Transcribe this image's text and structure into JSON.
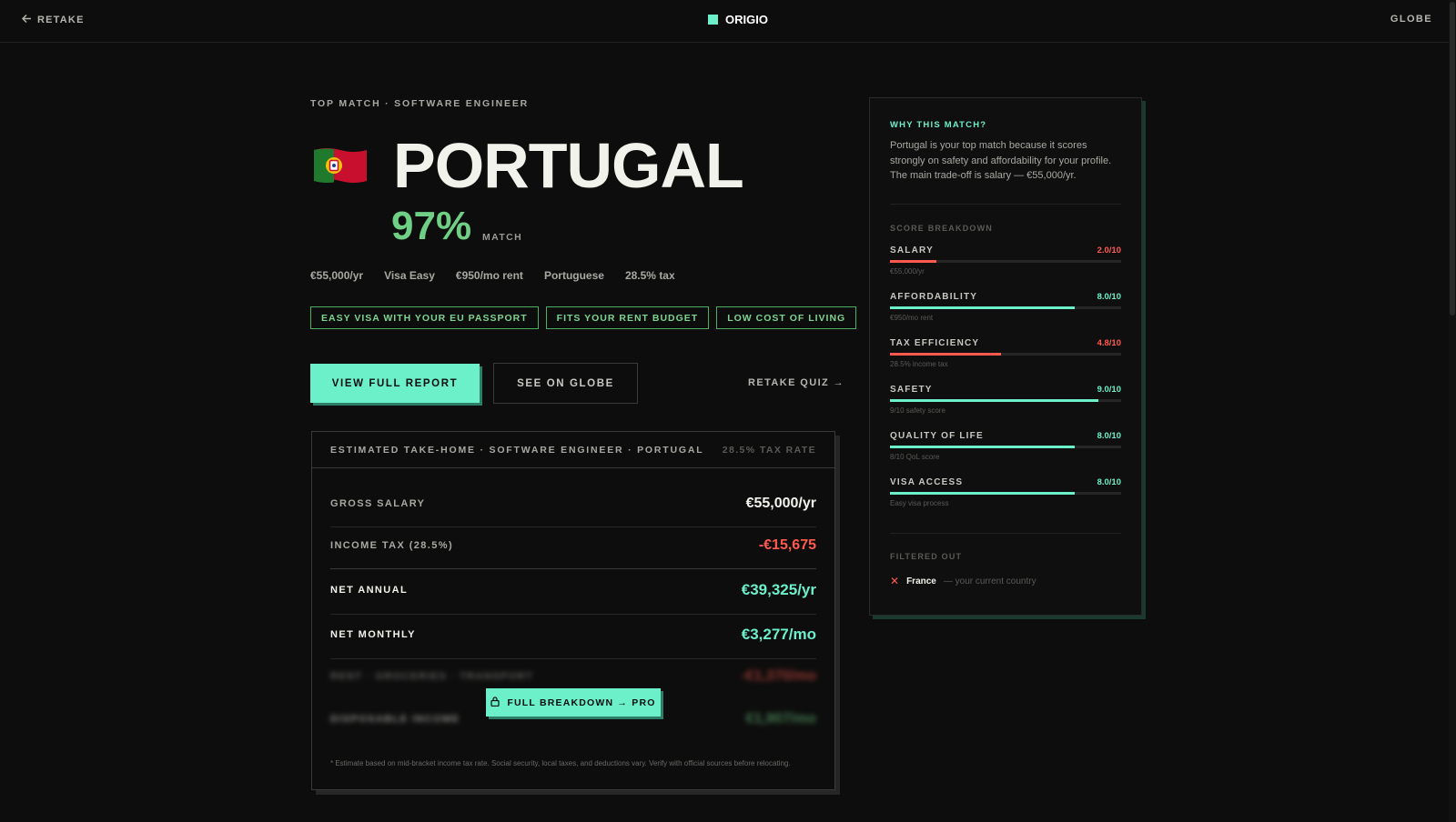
{
  "topbar": {
    "retake": "RETAKE",
    "brand": "ORIGIO",
    "globe": "GLOBE"
  },
  "hero": {
    "eyebrow": "TOP MATCH · SOFTWARE ENGINEER",
    "country": "PORTUGAL",
    "match_pct": "97%",
    "match_label": "MATCH",
    "flag": "portugal-flag-icon"
  },
  "facts": [
    "€55,000/yr",
    "Visa Easy",
    "€950/mo rent",
    "Portuguese",
    "28.5% tax"
  ],
  "tags": [
    "EASY VISA WITH YOUR EU PASSPORT",
    "FITS YOUR RENT BUDGET",
    "LOW COST OF LIVING"
  ],
  "actions": {
    "report": "VIEW FULL REPORT",
    "globe": "SEE ON GLOBE",
    "retake_quiz": "RETAKE QUIZ →"
  },
  "takehome": {
    "title": "ESTIMATED TAKE-HOME · SOFTWARE ENGINEER · PORTUGAL",
    "rate": "28.5% TAX RATE",
    "rows": [
      {
        "label": "GROSS SALARY",
        "value": "€55,000/yr"
      },
      {
        "label": "INCOME TAX (28.5%)",
        "value": "-€15,675"
      },
      {
        "label": "NET ANNUAL",
        "value": "€39,325/yr"
      },
      {
        "label": "NET MONTHLY",
        "value": "€3,277/mo"
      }
    ],
    "locked_rows": [
      {
        "label": "RENT · GROCERIES · TRANSPORT",
        "value": "-€1,370/mo"
      },
      {
        "label": "DISPOSABLE INCOME",
        "value": "€1,907/mo"
      }
    ],
    "unlock": "FULL BREAKDOWN → PRO",
    "footnote": "* Estimate based on mid-bracket income tax rate. Social security, local taxes, and deductions vary. Verify with official sources before relocating."
  },
  "sidebar": {
    "why_title": "WHY THIS MATCH?",
    "why_text": "Portugal is your top match because it scores strongly on safety and affordability for your profile. The main trade-off is salary — €55,000/yr.",
    "breakdown_title": "SCORE BREAKDOWN",
    "scores": [
      {
        "name": "SALARY",
        "score": "2.0/10",
        "value": 2.0,
        "sub": "€55,000/yr",
        "color": "#ff5a4d"
      },
      {
        "name": "AFFORDABILITY",
        "score": "8.0/10",
        "value": 8.0,
        "sub": "€950/mo rent",
        "color": "#6bf0c9"
      },
      {
        "name": "TAX EFFICIENCY",
        "score": "4.8/10",
        "value": 4.8,
        "sub": "28.5% income tax",
        "color": "#ff5a4d"
      },
      {
        "name": "SAFETY",
        "score": "9.0/10",
        "value": 9.0,
        "sub": "9/10 safety score",
        "color": "#6bf0c9"
      },
      {
        "name": "QUALITY OF LIFE",
        "score": "8.0/10",
        "value": 8.0,
        "sub": "8/10 QoL score",
        "color": "#6bf0c9"
      },
      {
        "name": "VISA ACCESS",
        "score": "8.0/10",
        "value": 8.0,
        "sub": "Easy visa process",
        "color": "#6bf0c9"
      }
    ],
    "filtered_title": "FILTERED OUT",
    "filtered_country": "France",
    "filtered_note": "— your current country"
  }
}
